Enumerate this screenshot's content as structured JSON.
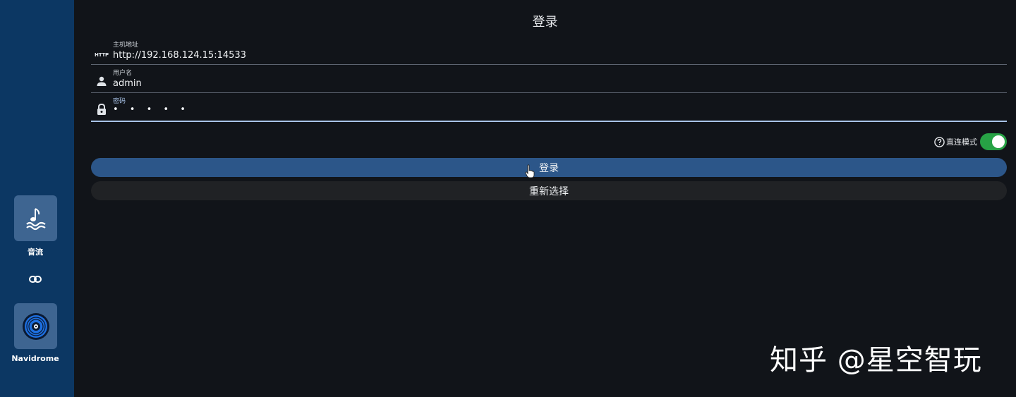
{
  "sidebar": {
    "apps": [
      {
        "label": "音流",
        "icon": "music-wave-icon"
      },
      {
        "label": "Navidrome",
        "icon": "vinyl-disc-icon"
      }
    ],
    "link_icon": "link-icon"
  },
  "login": {
    "title": "登录",
    "fields": {
      "host": {
        "label": "主机地址",
        "value": "http://192.168.124.15:14533",
        "icon": "http-icon",
        "icon_text": "HTTP"
      },
      "username": {
        "label": "用户名",
        "value": "admin",
        "icon": "person-icon"
      },
      "password": {
        "label": "密码",
        "value": "• • • • •",
        "icon": "lock-icon"
      }
    },
    "direct_mode": {
      "label": "直连模式",
      "enabled": true
    },
    "login_button": "登录",
    "reselect_button": "重新选择"
  },
  "watermark": "知乎 @星空智玩",
  "colors": {
    "sidebar_bg": "#0c3763",
    "page_bg": "#111419",
    "primary_button": "#2c5689",
    "secondary_button": "#202225",
    "toggle_on": "#27a245",
    "focus_underline": "#a9c3e8"
  }
}
